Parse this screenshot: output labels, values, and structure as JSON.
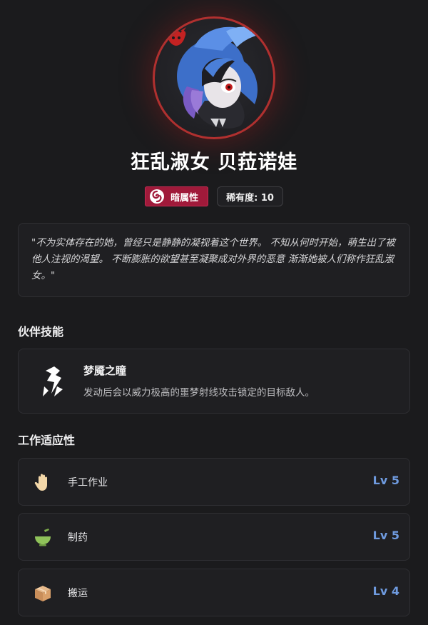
{
  "pal": {
    "name": "狂乱淑女 贝菈诺娃",
    "element_label": "暗属性",
    "rarity_label": "稀有度: 10",
    "description": "\"不为实体存在的她，曾经只是静静的凝视着这个世界。 不知从何时开始，萌生出了被他人注视的渴望。 不断膨胀的欲望甚至凝聚成对外界的恶意 渐渐她被人们称作狂乱淑女。\""
  },
  "skill_section": {
    "title": "伙伴技能",
    "skill": {
      "name": "梦魇之瞳",
      "description": "发动后会以威力极高的噩梦射线攻击锁定的目标敌人。",
      "icon": "nightmare-lightning-icon"
    }
  },
  "work_section": {
    "title": "工作适应性",
    "items": [
      {
        "label": "手工作业",
        "level": "Lv 5",
        "icon": "hand-icon"
      },
      {
        "label": "制药",
        "level": "Lv 5",
        "icon": "mortar-bowl-icon"
      },
      {
        "label": "搬运",
        "level": "Lv 4",
        "icon": "box-icon"
      }
    ]
  },
  "colors": {
    "element_badge": "#a01a3a",
    "avatar_ring": "#b0302f",
    "level_text": "#6f9be0",
    "background": "#1b1b1d"
  }
}
